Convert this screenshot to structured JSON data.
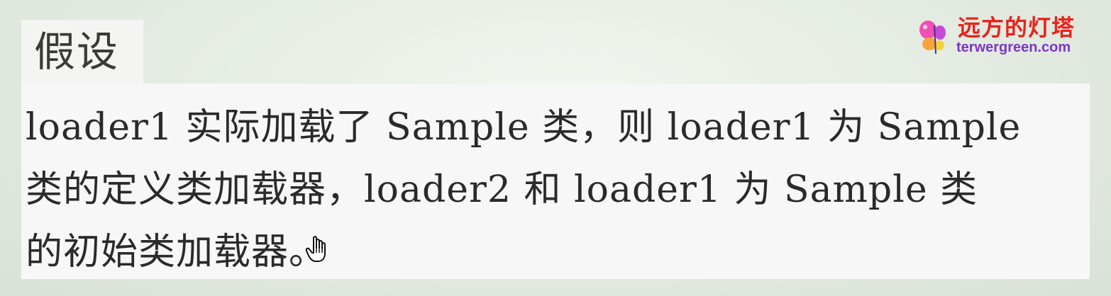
{
  "heading": {
    "label": "假设"
  },
  "body": {
    "lines": [
      "loader1 实际加载了 Sample 类，则 loader1 为 Sample",
      "类的定义类加载器，loader2 和 loader1 为 Sample 类",
      "的初始类加载器。"
    ]
  },
  "watermark": {
    "cn_text": "远方的灯塔",
    "domain": "terwergreen.com",
    "icon": "butterfly-logo-icon",
    "colors": {
      "cn_text": "#e8231c",
      "domain": "#7a37c9"
    }
  },
  "cursor": {
    "icon": "hand-pointer-cursor-icon"
  }
}
